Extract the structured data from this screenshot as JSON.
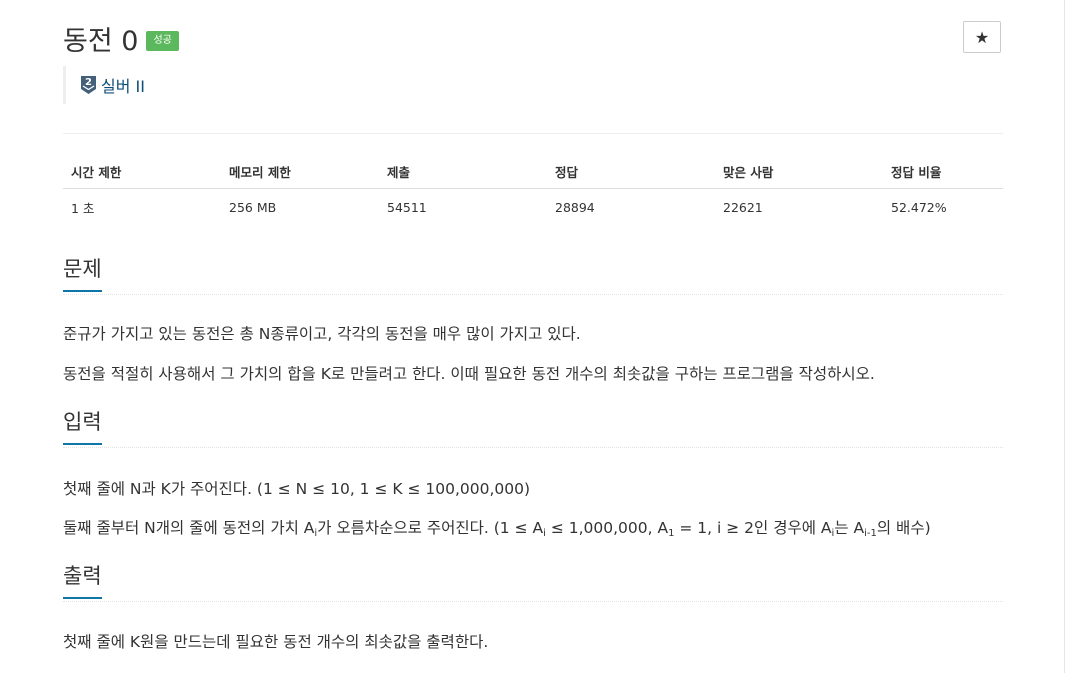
{
  "problem": {
    "title": "동전 0",
    "result_badge": "성공",
    "star_icon": "★",
    "tier": {
      "icon": "silver-2-tier-icon",
      "number": "2",
      "label": "실버 II"
    }
  },
  "info_table": {
    "headers": [
      "시간 제한",
      "메모리 제한",
      "제출",
      "정답",
      "맞은 사람",
      "정답 비율"
    ],
    "values": [
      "1 초",
      "256 MB",
      "54511",
      "28894",
      "22621",
      "52.472%"
    ]
  },
  "sections": {
    "description": {
      "heading": "문제",
      "paragraphs": [
        "준규가 가지고 있는 동전은 총 N종류이고, 각각의 동전을 매우 많이 가지고 있다.",
        "동전을 적절히 사용해서 그 가치의 합을 K로 만들려고 한다. 이때 필요한 동전 개수의 최솟값을 구하는 프로그램을 작성하시오."
      ]
    },
    "input": {
      "heading": "입력",
      "line1": "첫째 줄에 N과 K가 주어진다. (1 ≤ N ≤ 10, 1 ≤ K ≤ 100,000,000)",
      "line2": {
        "p1": "둘째 줄부터 N개의 줄에 동전의 가치 A",
        "sub1": "i",
        "p2": "가 오름차순으로 주어진다. (1 ≤ A",
        "sub2": "i",
        "p3": " ≤ 1,000,000, A",
        "sub3": "1",
        "p4": " = 1, i ≥ 2인 경우에 A",
        "sub4": "i",
        "p5": "는 A",
        "sub5": "i-1",
        "p6": "의 배수)"
      }
    },
    "output": {
      "heading": "출력",
      "paragraph": "첫째 줄에 K원을 만드는데 필요한 동전 개수의 최솟값을 출력한다."
    }
  },
  "colors": {
    "badge_success": "#5cb85c",
    "tier_text": "#0e4d7a",
    "section_underline": "#0e76a8",
    "silver_icon": "#435f7a"
  }
}
